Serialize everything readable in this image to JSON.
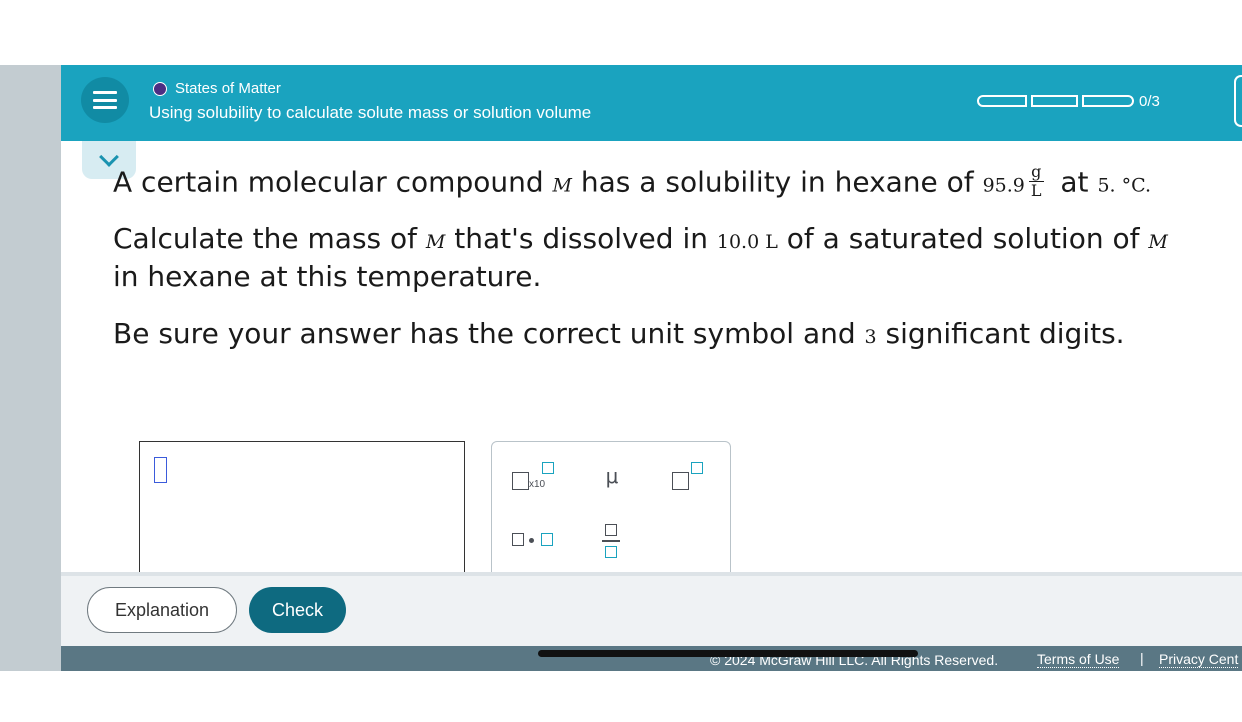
{
  "header": {
    "topic": "States of Matter",
    "subtitle": "Using solubility to calculate solute mass or solution volume",
    "progress_label": "0/3",
    "progress_value": 0,
    "progress_total": 3
  },
  "question": {
    "line1_pre": "A certain molecular compound ",
    "compound": "M",
    "line1_mid": " has a solubility in hexane of ",
    "solubility_value": "95.9",
    "unit_num": "g",
    "unit_den": "L",
    "line1_at": " at ",
    "temperature": "5. °C.",
    "line2_pre": "Calculate the mass of ",
    "line2_mid": " that's dissolved in ",
    "volume": "10.0 L",
    "line2_post": " of a saturated solution of ",
    "line3": "in hexane at this temperature.",
    "line4_pre": "Be sure your answer has the correct unit symbol and ",
    "sig_digits": "3",
    "line4_post": " significant digits."
  },
  "tools": {
    "x10_label": "x10",
    "mu_symbol": "μ"
  },
  "buttons": {
    "explanation": "Explanation",
    "check": "Check"
  },
  "footer": {
    "copyright": "© 2024 McGraw Hill LLC. All Rights Reserved.",
    "terms": "Terms of Use",
    "separator": "|",
    "privacy": "Privacy Cent"
  },
  "colors": {
    "header": "#1aa3bf",
    "check_button": "#0e6a80",
    "topic_dot": "#4b2e83"
  }
}
